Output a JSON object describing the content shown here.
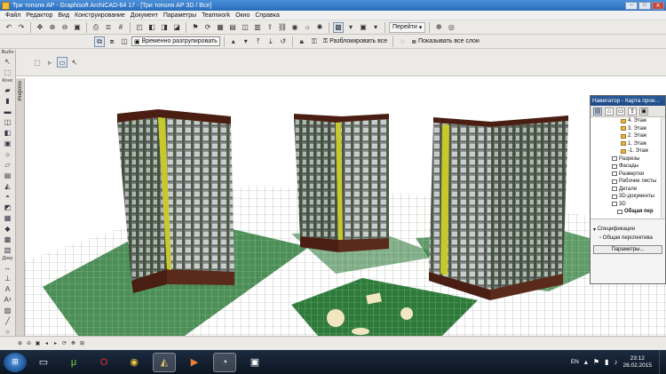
{
  "window": {
    "title": "Три тополя АР - Graphisoft ArchiCAD-64 17 - [Три тополя АР 3D / Все]",
    "buttons": {
      "minimize": "–",
      "maximize": "□",
      "close": "✕"
    }
  },
  "menu": [
    "Файл",
    "Редактор",
    "Вид",
    "Конструирование",
    "Документ",
    "Параметры",
    "Teamwork",
    "Окно",
    "Справка"
  ],
  "toolbar1": {
    "goto_label": "Перейти",
    "icons": [
      "undo-icon",
      "redo-icon",
      "pan-icon",
      "zoom-in-icon",
      "zoom-out-icon",
      "fit-icon",
      "print-icon",
      "layers-icon",
      "grid-icon",
      "3d-window-icon",
      "section-icon",
      "elevation-icon",
      "render-icon",
      "walk-icon",
      "orbit-icon",
      "layout-icon",
      "settings-icon",
      "eye-icon"
    ]
  },
  "toolbar2": {
    "temp_unhide_label": "Временно разгрупировать",
    "unlock_all_label": "Разблокировать все",
    "show_all_layers_label": "Показывать все слои"
  },
  "toolbox": {
    "select_label": "Выбо",
    "construct_label": "Конс",
    "document_label": "Доку"
  },
  "infobox": {
    "label": "Инфобо"
  },
  "navigator": {
    "title": "Навигатор - Карта прое...",
    "tree": [
      {
        "label": "4. Этаж",
        "indent": 3,
        "icon": "folder"
      },
      {
        "label": "3. Этаж",
        "indent": 3,
        "icon": "folder"
      },
      {
        "label": "2. Этаж",
        "indent": 3,
        "icon": "folder"
      },
      {
        "label": "1. Этаж",
        "indent": 3,
        "icon": "folder"
      },
      {
        "label": "-1. Этаж",
        "indent": 3,
        "icon": "folder"
      },
      {
        "label": "Разрезы",
        "indent": 2,
        "icon": "doc"
      },
      {
        "label": "Фасады",
        "indent": 2,
        "icon": "doc"
      },
      {
        "label": "Развертки",
        "indent": 2,
        "icon": "doc"
      },
      {
        "label": "Рабочие листы",
        "indent": 2,
        "icon": "doc"
      },
      {
        "label": "Детали",
        "indent": 2,
        "icon": "doc"
      },
      {
        "label": "3D-документы",
        "indent": 2,
        "icon": "doc"
      },
      {
        "label": "3D",
        "indent": 2,
        "icon": "doc"
      },
      {
        "label": "Общая пер",
        "indent": 3,
        "icon": "doc",
        "bold": true
      }
    ],
    "spec_label": "Спецификации",
    "view_label": "Общая перспектива",
    "params_button": "Параметры..."
  },
  "taskbar": {
    "lang": "EN",
    "time": "23:12",
    "date": "26.02.2015"
  },
  "colors": {
    "grass": "#2f7a3a",
    "grid": "#cfe8cf",
    "facade_light": "#8d9092",
    "facade_dark": "#4c5a44",
    "accent_yellow": "#c7c82b",
    "roof": "#4a1e12"
  }
}
